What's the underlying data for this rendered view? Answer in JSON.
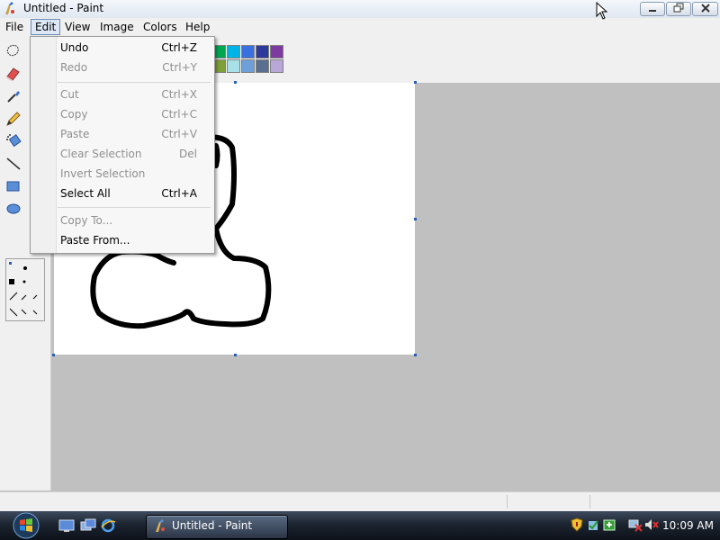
{
  "window": {
    "title": "Untitled - Paint"
  },
  "menubar": {
    "items": [
      "File",
      "Edit",
      "View",
      "Image",
      "Colors",
      "Help"
    ],
    "active": "Edit"
  },
  "edit_menu": {
    "items": [
      {
        "label": "Undo",
        "shortcut": "Ctrl+Z",
        "enabled": true
      },
      {
        "label": "Redo",
        "shortcut": "Ctrl+Y",
        "enabled": false
      },
      {
        "label": "Cut",
        "shortcut": "Ctrl+X",
        "enabled": false
      },
      {
        "label": "Copy",
        "shortcut": "Ctrl+C",
        "enabled": false
      },
      {
        "label": "Paste",
        "shortcut": "Ctrl+V",
        "enabled": false
      },
      {
        "label": "Clear Selection",
        "shortcut": "Del",
        "enabled": false
      },
      {
        "label": "Invert Selection",
        "shortcut": "",
        "enabled": false
      },
      {
        "label": "Select All",
        "shortcut": "Ctrl+A",
        "enabled": true
      },
      {
        "label": "Copy To...",
        "shortcut": "",
        "enabled": false
      },
      {
        "label": "Paste From...",
        "shortcut": "",
        "enabled": true
      }
    ]
  },
  "palette": {
    "row1": [
      "#00a651",
      "#00b4e6",
      "#3a6fe0",
      "#2e3a9b",
      "#7d3aa0"
    ],
    "row2": [
      "#7f9f3a",
      "#a8e0e8",
      "#6f9fd8",
      "#5a6f8f",
      "#b8a8d8"
    ]
  },
  "tools": [
    "free-form-select-icon",
    "eraser-icon",
    "color-picker-icon",
    "pencil-icon",
    "airbrush-icon",
    "line-icon",
    "rectangle-icon",
    "ellipse-icon"
  ],
  "taskbar": {
    "task_label": "Untitled - Paint",
    "clock": "10:09 AM"
  }
}
